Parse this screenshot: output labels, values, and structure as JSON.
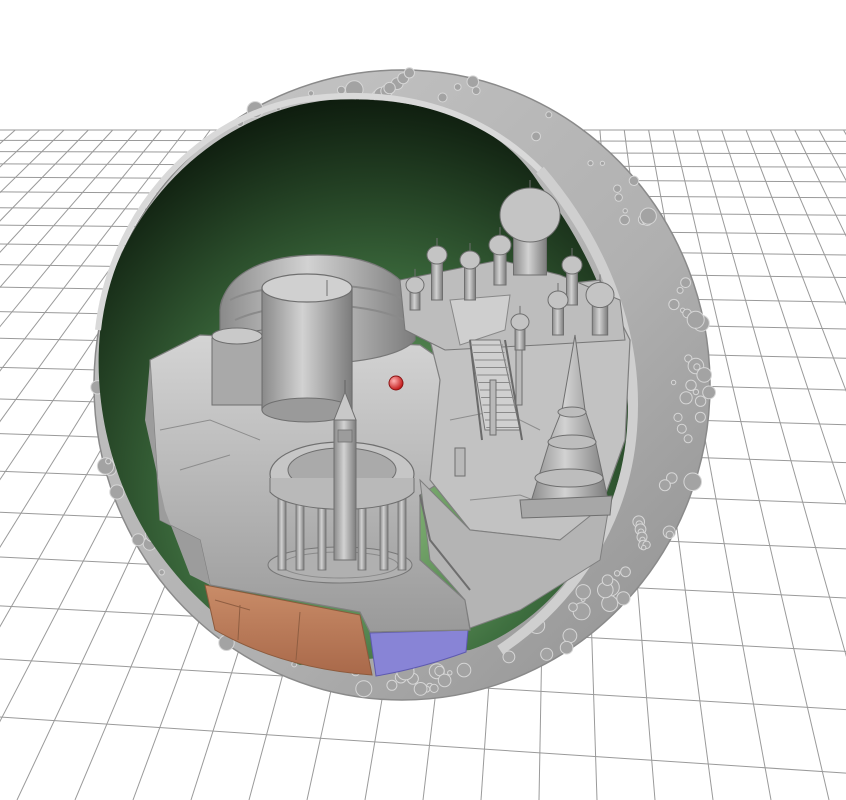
{
  "viewport": {
    "background": "#ffffff",
    "grid_color": "#9a9a9a"
  },
  "model": {
    "shell_color": "#b7b7b7",
    "interior_gradient": [
      "#0c1a0c",
      "#2f5a2f",
      "#7aa66e"
    ],
    "rock_color": "#bdbdbd",
    "soil_color": "#b97d5a",
    "water_color": "#8a86d8",
    "marker_color": "#e23a3a",
    "selected": true
  }
}
